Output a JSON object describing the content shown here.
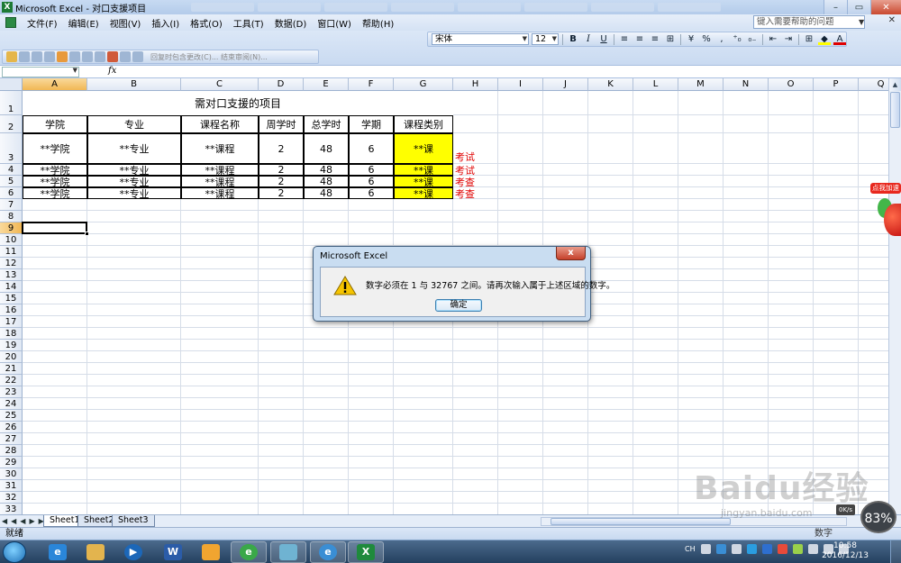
{
  "window": {
    "title": "Microsoft Excel - 对口支援项目"
  },
  "menu": [
    "文件(F)",
    "编辑(E)",
    "视图(V)",
    "插入(I)",
    "格式(O)",
    "工具(T)",
    "数据(D)",
    "窗口(W)",
    "帮助(H)"
  ],
  "help_placeholder": "键入需要帮助的问题",
  "toolbar": {
    "reply_label": "回复时包含更改(C)... 结束审阅(N)...",
    "font_name": "宋体",
    "font_size": "12",
    "bold": "B",
    "italic": "I",
    "underline": "U",
    "percent": "%",
    "comma": ",",
    "fill_color": "#ffff00",
    "font_color": "#e00000"
  },
  "formula": {
    "fx": "fx"
  },
  "columns": [
    "A",
    "B",
    "C",
    "D",
    "E",
    "F",
    "G",
    "H",
    "I",
    "J",
    "K",
    "L",
    "M",
    "N",
    "O",
    "P",
    "Q"
  ],
  "rows": [
    "1",
    "2",
    "3",
    "4",
    "5",
    "6",
    "7",
    "8",
    "9",
    "10",
    "11",
    "12",
    "13",
    "14",
    "15",
    "16",
    "17",
    "18",
    "19",
    "20",
    "21",
    "22",
    "23",
    "24",
    "25",
    "26",
    "27",
    "28",
    "29",
    "30",
    "31",
    "32",
    "33"
  ],
  "sheet": {
    "title": "需对口支援的项目",
    "headers": [
      "学院",
      "专业",
      "课程名称",
      "周学时",
      "总学时",
      "学期",
      "课程类别"
    ],
    "rows": [
      [
        "**学院",
        "**专业",
        "**课程",
        "2",
        "48",
        "6",
        "**课",
        "考试"
      ],
      [
        "**学院",
        "**专业",
        "**课程",
        "2",
        "48",
        "6",
        "**课",
        "考试"
      ],
      [
        "**学院",
        "**专业",
        "**课程",
        "2",
        "48",
        "6",
        "**课",
        "考查"
      ],
      [
        "**学院",
        "**专业",
        "**课程",
        "2",
        "48",
        "6",
        "**课",
        "考查"
      ]
    ],
    "active_cell": "A9"
  },
  "tabs": [
    "Sheet1",
    "Sheet2",
    "Sheet3"
  ],
  "active_tab": "Sheet1",
  "status": {
    "left": "就绪",
    "right": "数字"
  },
  "dialog": {
    "title": "Microsoft Excel",
    "message": "数字必须在 1 与 32767 之间。请再次输入属于上述区域的数字。",
    "ok": "确定",
    "close": "x"
  },
  "side_widget": {
    "badge": "点我加速",
    "speed": "83%",
    "net": "0K/s"
  },
  "watermark": {
    "main": "Baidu经验",
    "sub": "jingyan.baidu.com"
  },
  "taskbar": {
    "lang": "CH",
    "time": "10:58",
    "date": "2016/12/13"
  }
}
